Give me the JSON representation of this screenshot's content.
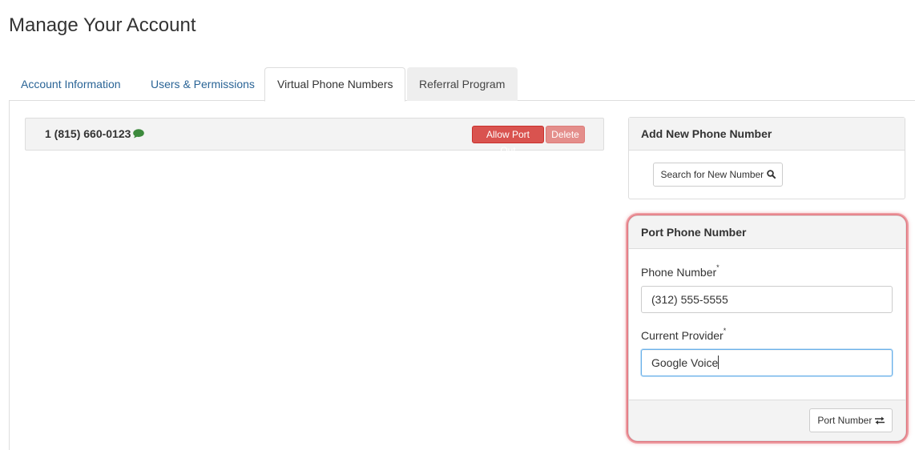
{
  "page": {
    "title": "Manage Your Account"
  },
  "tabs": [
    {
      "label": "Account Information"
    },
    {
      "label": "Users & Permissions"
    },
    {
      "label": "Virtual Phone Numbers"
    },
    {
      "label": "Referral Program"
    }
  ],
  "numbers": [
    {
      "number": "1 (815) 660-0123",
      "icon": "sms-bubble-icon",
      "allow_port_out_label": "Allow Port Out",
      "delete_label": "Delete"
    }
  ],
  "add_panel": {
    "heading": "Add New Phone Number",
    "search_button_label": "Search for New Number",
    "search_icon": "search-icon"
  },
  "port_panel": {
    "heading": "Port Phone Number",
    "phone_label": "Phone Number",
    "phone_required": "*",
    "phone_value": "(312) 555-5555",
    "provider_label": "Current Provider",
    "provider_required": "*",
    "provider_value": "Google Voice",
    "port_button_label": "Port Number",
    "port_icon": "exchange-arrows-icon"
  },
  "colors": {
    "link": "#2a6496",
    "danger": "#d9534f",
    "danger_light": "#e48e8b",
    "sms_icon": "#3c8a3c",
    "highlight": "#e0505a",
    "focus": "#66afe9"
  }
}
